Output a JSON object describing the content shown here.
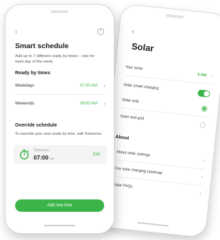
{
  "colors": {
    "accent": "#3bb54a",
    "text": "#1c1c1c",
    "muted": "#555555"
  },
  "front": {
    "icons": {
      "back": "chevron-left-icon",
      "help": "help-circle-icon",
      "timer": "stopwatch-icon",
      "chevron": "chevron-right-icon"
    },
    "back_glyph": "‹",
    "help_glyph": "?",
    "title": "Smart schedule",
    "description": "Add up to 7 different ready by times – one for each day of the week.",
    "ready_by_heading": "Ready by times",
    "rows": [
      {
        "label": "Weekdays",
        "value": "07:00 AM",
        "chevron": "›"
      },
      {
        "label": "Weekends",
        "value": "09:00 AM",
        "chevron": "›"
      }
    ],
    "override_heading": "Override schedule",
    "override_description": "To override your next ready by time, edit Tomorrow.",
    "override_card": {
      "day": "Tomorrow",
      "time": "07:00",
      "ampm": "AM",
      "edit": "Edit"
    },
    "add_button": "Add new time"
  },
  "back": {
    "back_glyph": "‹",
    "title": "Solar",
    "rows": [
      {
        "label": "Your array",
        "value": "5 kW",
        "chevron": "›",
        "control": "chevron"
      },
      {
        "label": "Solar smart charging",
        "control": "toggle",
        "on": true
      },
      {
        "label": "Solar only",
        "control": "radio",
        "on": true
      },
      {
        "label": "Solar and grid",
        "control": "radio",
        "on": false
      }
    ],
    "about_heading": "About",
    "about_items": [
      {
        "label": "About solar settings",
        "chevron": "›"
      },
      {
        "label": "Our solar charging roadmap",
        "chevron": "›"
      },
      {
        "label": "Solar FAQs",
        "chevron": "›"
      }
    ]
  }
}
